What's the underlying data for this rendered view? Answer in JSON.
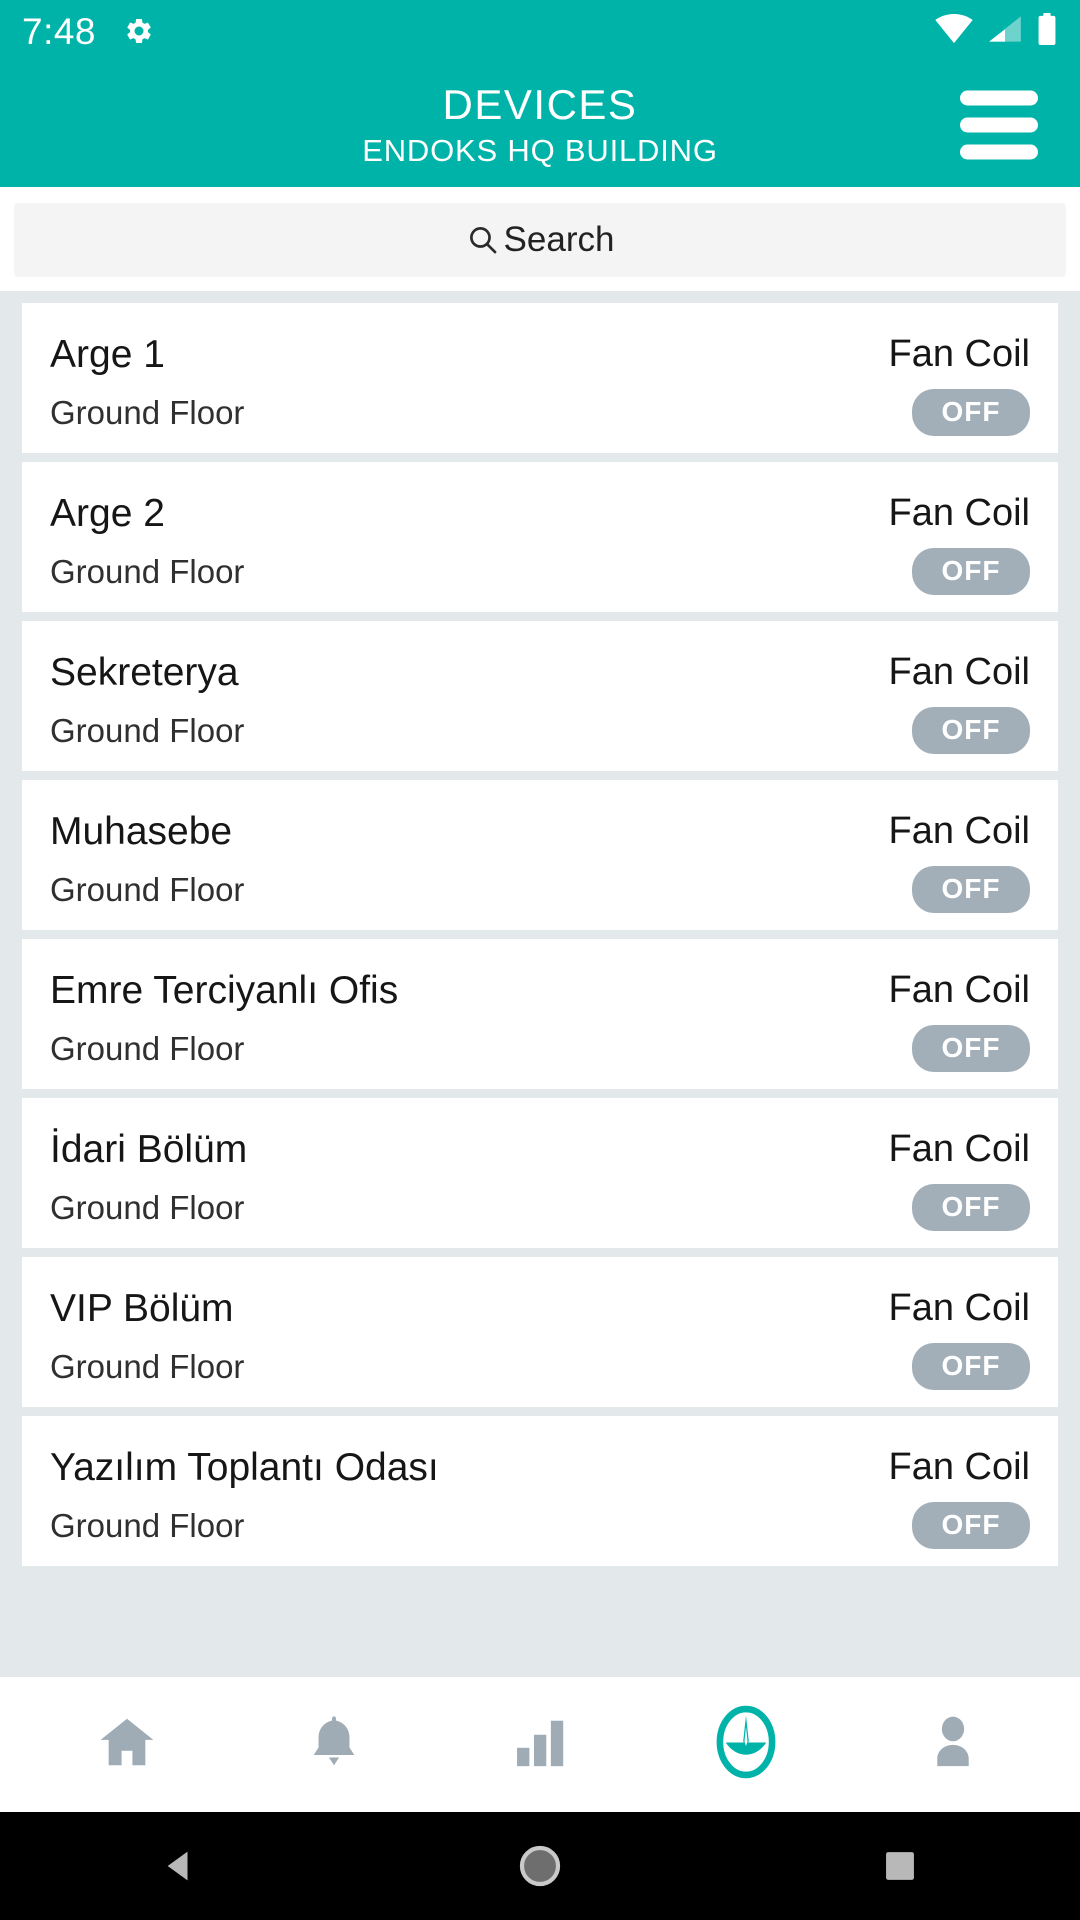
{
  "status_bar": {
    "time": "7:48",
    "icons": [
      "gear-icon",
      "wifi-icon",
      "cellular-signal-icon",
      "battery-icon"
    ]
  },
  "app_bar": {
    "title": "DEVICES",
    "subtitle": "ENDOKS HQ BUILDING",
    "menu_icon": "hamburger-menu-icon"
  },
  "search": {
    "placeholder": "Search",
    "icon": "search-icon"
  },
  "devices": [
    {
      "name": "Arge 1",
      "type": "Fan Coil",
      "floor": "Ground Floor",
      "state": "OFF"
    },
    {
      "name": "Arge 2",
      "type": "Fan Coil",
      "floor": "Ground Floor",
      "state": "OFF"
    },
    {
      "name": "Sekreterya",
      "type": "Fan Coil",
      "floor": "Ground Floor",
      "state": "OFF"
    },
    {
      "name": "Muhasebe",
      "type": "Fan Coil",
      "floor": "Ground Floor",
      "state": "OFF"
    },
    {
      "name": "Emre Terciyanlı Ofis",
      "type": "Fan Coil",
      "floor": "Ground Floor",
      "state": "OFF"
    },
    {
      "name": "İdari Bölüm",
      "type": "Fan Coil",
      "floor": "Ground Floor",
      "state": "OFF"
    },
    {
      "name": "VIP Bölüm",
      "type": "Fan Coil",
      "floor": "Ground Floor",
      "state": "OFF"
    },
    {
      "name": "Yazılım Toplantı Odası",
      "type": "Fan Coil",
      "floor": "Ground Floor",
      "state": "OFF"
    }
  ],
  "bottom_nav": {
    "items": [
      {
        "icon": "home-icon",
        "active": false
      },
      {
        "icon": "bell-icon",
        "active": false
      },
      {
        "icon": "bar-chart-icon",
        "active": false
      },
      {
        "icon": "device-gauge-icon",
        "active": true
      },
      {
        "icon": "person-icon",
        "active": false
      }
    ]
  },
  "android_nav": {
    "back": "back-triangle-icon",
    "home": "home-circle-icon",
    "recents": "recents-square-icon"
  },
  "colors": {
    "accent": "#00b3a9",
    "badge_off": "#a3afb8",
    "list_background": "#e3e8ea",
    "nav_inactive": "#9facb5",
    "card": "#ffffff"
  }
}
